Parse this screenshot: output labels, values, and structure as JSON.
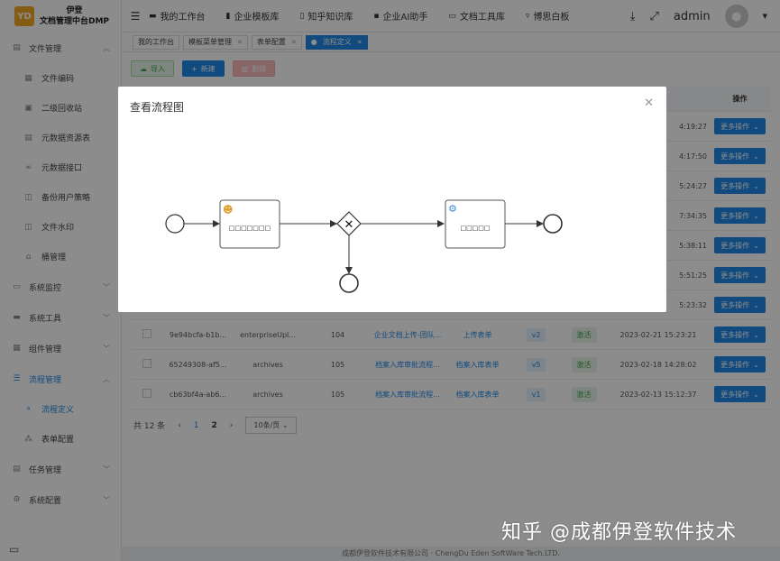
{
  "app": {
    "logo_mark": "YD",
    "logo_line1": "伊登",
    "logo_line2": "文档管理中台DMP"
  },
  "sidebar": {
    "groups": [
      {
        "label": "文件管理",
        "icon": "file-icon",
        "items": [
          {
            "label": "文件编码",
            "icon": "code-icon"
          },
          {
            "label": "二级回收站",
            "icon": "recycle-icon"
          },
          {
            "label": "元数据资源表",
            "icon": "database-icon"
          },
          {
            "label": "元数据接口",
            "icon": "link-icon"
          },
          {
            "label": "备份用户策略",
            "icon": "book-icon"
          },
          {
            "label": "文件水印",
            "icon": "book-icon"
          },
          {
            "label": "桶管理",
            "icon": "bucket-icon"
          }
        ]
      },
      {
        "label": "系统监控",
        "icon": "monitor-icon"
      },
      {
        "label": "系统工具",
        "icon": "toolbox-icon"
      },
      {
        "label": "组件管理",
        "icon": "grid-icon"
      },
      {
        "label": "流程管理",
        "icon": "flow-icon",
        "items": [
          {
            "label": "流程定义",
            "icon": "flow-def-icon"
          },
          {
            "label": "表单配置",
            "icon": "form-icon"
          }
        ]
      },
      {
        "label": "任务管理",
        "icon": "task-icon"
      },
      {
        "label": "系统配置",
        "icon": "settings-icon"
      }
    ]
  },
  "header": {
    "nav": [
      {
        "label": "我的工作台",
        "icon": "desktop-icon"
      },
      {
        "label": "企业模板库",
        "icon": "bar-chart-icon"
      },
      {
        "label": "知乎知识库",
        "icon": "book-open-icon"
      },
      {
        "label": "企业AI助手",
        "icon": "chat-icon"
      },
      {
        "label": "文档工具库",
        "icon": "monitor-icon"
      },
      {
        "label": "博思白板",
        "icon": "board-icon"
      }
    ],
    "user": "admin"
  },
  "tabs": [
    {
      "label": "我的工作台",
      "closable": false
    },
    {
      "label": "模板菜单管理",
      "closable": true
    },
    {
      "label": "表单配置",
      "closable": true
    },
    {
      "label": "流程定义",
      "closable": true,
      "active": true
    }
  ],
  "toolbar": {
    "import": "导入",
    "new": "新建",
    "delete": "删除"
  },
  "table": {
    "op_header": "操作",
    "op_label": "更多操作",
    "hidden_rows": [
      {
        "time": "4:19:27"
      },
      {
        "time": "4:17:50"
      },
      {
        "time": "5:24:27"
      },
      {
        "time": "7:34:35"
      },
      {
        "time": "5:38:11"
      },
      {
        "time": "5:51:25"
      },
      {
        "time": "5:23:32"
      }
    ],
    "rows": [
      {
        "id": "9e94bcfa-b1b...",
        "key": "enterpriseUpl...",
        "sort": "104",
        "name": "企业文档上传-团队...",
        "form": "上传表单",
        "version": "v2",
        "status": "激活",
        "time": "2023-02-21 15:23:21"
      },
      {
        "id": "65249308-af5...",
        "key": "archives",
        "sort": "105",
        "name": "档案入库审批流程...",
        "form": "档案入库表单",
        "version": "v5",
        "status": "激活",
        "time": "2023-02-18 14:28:02"
      },
      {
        "id": "cb63bf4a-ab6...",
        "key": "archives",
        "sort": "105",
        "name": "档案入库审批流程...",
        "form": "档案入库表单",
        "version": "v1",
        "status": "激活",
        "time": "2023-02-13 15:12:37"
      }
    ]
  },
  "pager": {
    "total": "共 12 条",
    "pages": [
      "1",
      "2"
    ],
    "current": "1",
    "size": "10条/页"
  },
  "footer": "成都伊登软件技术有限公司 · ChengDu Eden SoftWare Tech.LTD.",
  "watermark": "知乎 @成都伊登软件技术",
  "modal": {
    "title": "查看流程图",
    "user_task": "□□□□□□□",
    "service_task": "□□□□□"
  },
  "colors": {
    "primary": "#1e88e5",
    "success": "#43a047"
  }
}
